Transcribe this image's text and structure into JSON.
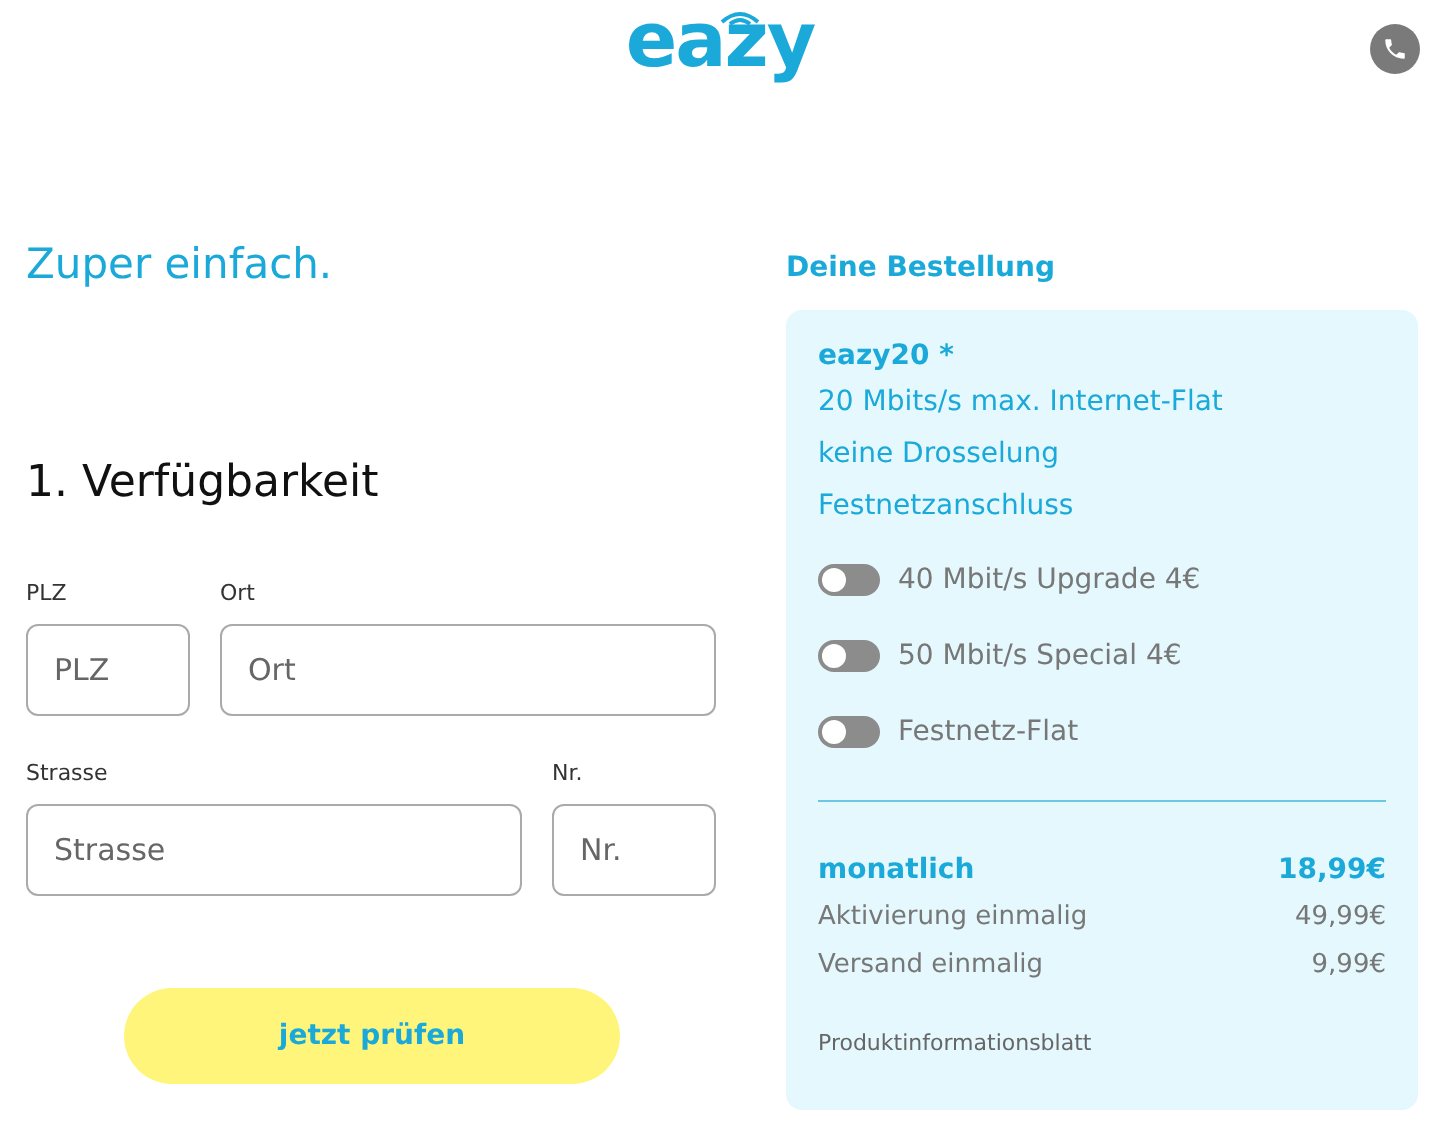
{
  "header": {
    "logo": "eazy"
  },
  "intro": {
    "headline": "Zuper einfach."
  },
  "availability": {
    "title": "1. Verfügbarkeit",
    "rows": [
      [
        {
          "label": "PLZ",
          "placeholder": "PLZ"
        },
        {
          "label": "Ort",
          "placeholder": "Ort"
        }
      ],
      [
        {
          "label": "Strasse",
          "placeholder": "Strasse"
        },
        {
          "label": "Nr.",
          "placeholder": "Nr."
        }
      ]
    ],
    "button": "jetzt prüfen"
  },
  "order": {
    "title": "Deine Bestellung",
    "product": "eazy20 *",
    "features": [
      "20 Mbits/s max. Internet-Flat",
      "keine Drosselung",
      "Festnetzanschluss"
    ],
    "options": [
      {
        "label": "40 Mbit/s Upgrade 4€",
        "on": false
      },
      {
        "label": "50 Mbit/s Special 4€",
        "on": false
      },
      {
        "label": "Festnetz-Flat",
        "on": false
      }
    ],
    "monthly": {
      "label": "monatlich",
      "price": "18,99€"
    },
    "fees": [
      {
        "label": "Aktivierung einmalig",
        "price": "49,99€"
      },
      {
        "label": "Versand einmalig",
        "price": "9,99€"
      }
    ],
    "info_link": "Produktinformationsblatt"
  }
}
